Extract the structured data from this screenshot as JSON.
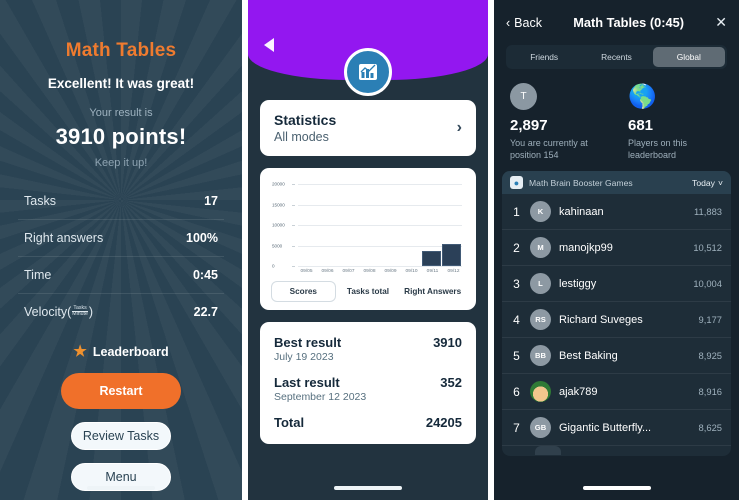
{
  "results": {
    "title": "Math Tables",
    "subtitle": "Excellent! It was great!",
    "result_label": "Your result is",
    "points": "3910 points!",
    "keep_up": "Keep it up!",
    "stats": [
      {
        "label": "Tasks",
        "value": "17"
      },
      {
        "label": "Right answers",
        "value": "100%"
      },
      {
        "label": "Time",
        "value": "0:45"
      },
      {
        "label": "Velocity",
        "value": "22.7",
        "unit_num": "Tasks",
        "unit_den": "Minute"
      }
    ],
    "leaderboard_link": "Leaderboard",
    "star_icon": "star-icon",
    "buttons": {
      "restart": "Restart",
      "review": "Review Tasks",
      "menu": "Menu"
    },
    "accent": "#f0702a",
    "background": "#2a4353"
  },
  "statistics": {
    "back_icon": "back-triangle-icon",
    "badge_icon": "chart-icon",
    "header_band_color": "#9317f0",
    "card": {
      "title": "Statistics",
      "subtitle": "All modes",
      "chevron": "chevron-right-icon"
    },
    "tabs": [
      {
        "label": "Scores",
        "active": true
      },
      {
        "label": "Tasks total",
        "active": false
      },
      {
        "label": "Right Answers",
        "active": false
      }
    ],
    "results": {
      "best_label": "Best result",
      "best_value": "3910",
      "best_date": "July 19 2023",
      "last_label": "Last result",
      "last_value": "352",
      "last_date": "September 12 2023",
      "total_label": "Total",
      "total_value": "24205"
    }
  },
  "chart_data": {
    "type": "bar",
    "title": "Scores",
    "categories": [
      "09/05",
      "09/06",
      "09/07",
      "09/08",
      "09/09",
      "09/10",
      "09/11",
      "09/12"
    ],
    "values": [
      0,
      0,
      0,
      0,
      0,
      0,
      3600,
      5400
    ],
    "yticks": [
      "20000",
      "15000",
      "10000",
      "5000",
      "0"
    ],
    "ylim": [
      0,
      20000
    ],
    "xlabel": "",
    "ylabel": "",
    "grid": true,
    "legend": "none",
    "bar_color": "#2b4058"
  },
  "leaderboard": {
    "back_label": "Back",
    "back_icon": "chevron-left-icon",
    "title": "Math Tables (0:45)",
    "close_icon": "close-icon",
    "segments": [
      {
        "label": "Friends",
        "active": false
      },
      {
        "label": "Recents",
        "active": false
      },
      {
        "label": "Global",
        "active": true
      }
    ],
    "summary": [
      {
        "icon": "avatar-icon",
        "avatar_initial": "T",
        "value": "2,897",
        "caption": "You are currently at position 154"
      },
      {
        "icon": "globe-icon",
        "value": "681",
        "caption": "Players on this leaderboard"
      }
    ],
    "banner": {
      "app_icon": "app-icon",
      "name": "Math Brain Booster Games",
      "period": "Today",
      "chevron": "chevron-down-icon"
    },
    "rows": [
      {
        "rank": "1",
        "initials": "K",
        "name": "kahinaan",
        "score": "11,883"
      },
      {
        "rank": "2",
        "initials": "M",
        "name": "manojkp99",
        "score": "10,512"
      },
      {
        "rank": "3",
        "initials": "L",
        "name": "lestiggy",
        "score": "10,004"
      },
      {
        "rank": "4",
        "initials": "RS",
        "name": "Richard Suveges",
        "score": "9,177"
      },
      {
        "rank": "5",
        "initials": "BB",
        "name": "Best Baking",
        "score": "8,925"
      },
      {
        "rank": "6",
        "initials": "",
        "name": "ajak789",
        "score": "8,916",
        "photo": true
      },
      {
        "rank": "7",
        "initials": "GB",
        "name": "Gigantic Butterfly...",
        "score": "8,625"
      }
    ]
  }
}
